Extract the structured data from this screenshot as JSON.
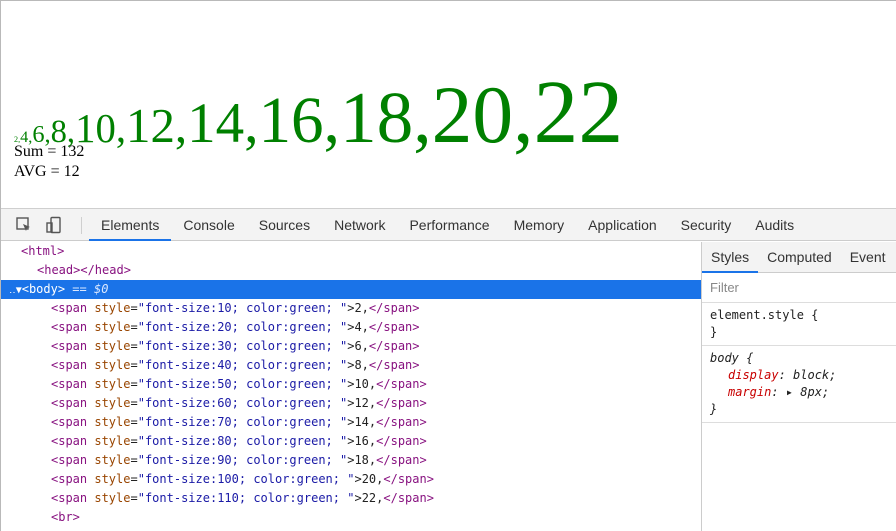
{
  "page": {
    "numbers": [
      {
        "text": "2,",
        "size": 10
      },
      {
        "text": "4,",
        "size": 20
      },
      {
        "text": "6,",
        "size": 30
      },
      {
        "text": "8,",
        "size": 40
      },
      {
        "text": "10,",
        "size": 50
      },
      {
        "text": "12,",
        "size": 60
      },
      {
        "text": "14,",
        "size": 70
      },
      {
        "text": "16,",
        "size": 80
      },
      {
        "text": "18,",
        "size": 90
      },
      {
        "text": "20,",
        "size": 100
      },
      {
        "text": "22",
        "size": 110
      }
    ],
    "sum": "Sum = 132",
    "avg": "AVG = 12",
    "number_color": "#008000"
  },
  "devtools": {
    "tabs": [
      "Elements",
      "Console",
      "Sources",
      "Network",
      "Performance",
      "Memory",
      "Application",
      "Security",
      "Audits"
    ],
    "active_tab": "Elements",
    "dom": {
      "html": "<html>",
      "head": "<head></head>",
      "body_open": "<body>",
      "body_marker": " == $0",
      "spans": [
        {
          "open": "<span ",
          "attr": "style",
          "value": "\"font-size:10; color:green; \"",
          "text": ">2,",
          "close": "</span>"
        },
        {
          "open": "<span ",
          "attr": "style",
          "value": "\"font-size:20; color:green; \"",
          "text": ">4,",
          "close": "</span>"
        },
        {
          "open": "<span ",
          "attr": "style",
          "value": "\"font-size:30; color:green; \"",
          "text": ">6,",
          "close": "</span>"
        },
        {
          "open": "<span ",
          "attr": "style",
          "value": "\"font-size:40; color:green; \"",
          "text": ">8,",
          "close": "</span>"
        },
        {
          "open": "<span ",
          "attr": "style",
          "value": "\"font-size:50; color:green; \"",
          "text": ">10,",
          "close": "</span>"
        },
        {
          "open": "<span ",
          "attr": "style",
          "value": "\"font-size:60; color:green; \"",
          "text": ">12,",
          "close": "</span>"
        },
        {
          "open": "<span ",
          "attr": "style",
          "value": "\"font-size:70; color:green; \"",
          "text": ">14,",
          "close": "</span>"
        },
        {
          "open": "<span ",
          "attr": "style",
          "value": "\"font-size:80; color:green; \"",
          "text": ">16,",
          "close": "</span>"
        },
        {
          "open": "<span ",
          "attr": "style",
          "value": "\"font-size:90; color:green; \"",
          "text": ">18,",
          "close": "</span>"
        },
        {
          "open": "<span ",
          "attr": "style",
          "value": "\"font-size:100; color:green; \"",
          "text": ">20,",
          "close": "</span>"
        },
        {
          "open": "<span ",
          "attr": "style",
          "value": "\"font-size:110; color:green; \"",
          "text": ">22,",
          "close": "</span>"
        }
      ],
      "br": "<br>"
    },
    "side_tabs": [
      "Styles",
      "Computed",
      "Event"
    ],
    "active_side_tab": "Styles",
    "filter_placeholder": "Filter",
    "rules": {
      "element_style": {
        "selector": "element.style {",
        "close": "}"
      },
      "body": {
        "selector": "body {",
        "props": [
          {
            "name": "display",
            "value": "block;"
          },
          {
            "name": "margin",
            "value": "8px;"
          }
        ],
        "close": "}"
      }
    },
    "accent_color": "#1a73e8"
  }
}
